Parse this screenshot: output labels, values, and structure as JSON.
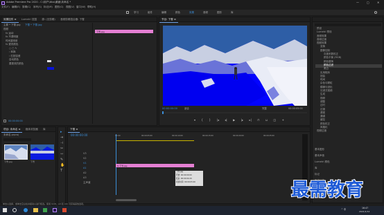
{
  "app": {
    "title": "Adobe Premiere Pro 2020 - C:\\用户\\ttbx\\桌面\\未命名 *",
    "window_controls": [
      "—",
      "▢",
      "✕"
    ]
  },
  "menu": [
    "文件(F)",
    "编辑(E)",
    "剪辑(C)",
    "序列(S)",
    "标记(M)",
    "图形(G)",
    "视图(V)",
    "窗口(W)",
    "帮助(H)"
  ],
  "workspace_tabs": [
    "学习",
    "组件",
    "编辑",
    "颜色",
    "效果",
    "音频",
    "图形",
    "库"
  ],
  "workspace_active": "效果",
  "effect_controls": {
    "tabs": [
      "效果控件 ≡",
      "Lumetri 范围",
      "源: (无剪辑)",
      "音频剪辑混合器: 下雪"
    ],
    "master": "主要 * 下雪.jpg",
    "clip": "下雪 * 下雪.jpg",
    "timecode_label": "▸",
    "rows": [
      {
        "label": "视频",
        "indent": 0
      },
      {
        "label": "fx 运动",
        "indent": 1
      },
      {
        "label": "fx 不透明度",
        "indent": 1
      },
      {
        "label": "时间重映射",
        "indent": 1
      },
      {
        "label": "fx 更改颜色",
        "indent": 1
      },
      {
        "label": "○ □ ✎",
        "indent": 2
      },
      {
        "label": "› 转换",
        "indent": 2
      },
      {
        "label": "› 匹配容差",
        "indent": 2
      },
      {
        "label": "自动颜色",
        "indent": 2
      },
      {
        "label": "要更改的颜色",
        "indent": 2
      }
    ],
    "clip_bar_label": "下雪.jpg",
    "bottom_timecode": "00:00:00:00"
  },
  "program": {
    "tab": "节目: 下雪 ≡",
    "timecode": "00:00:00:00",
    "fit": "适合",
    "ratio": "完整",
    "duration": "00:00:05:00"
  },
  "effects_panel": {
    "items": [
      {
        "label": "预设",
        "indent": 0
      },
      {
        "label": "Lumetri 预设",
        "indent": 0
      },
      {
        "label": "音频效果",
        "indent": 0
      },
      {
        "label": "音频过渡",
        "indent": 0
      },
      {
        "label": "视频效果",
        "indent": 0
      },
      {
        "label": "变换",
        "indent": 1
      },
      {
        "label": "图像控制",
        "indent": 1
      },
      {
        "label": "灰度系数校正",
        "indent": 2
      },
      {
        "label": "颜色平衡 (RGB)",
        "indent": 2
      },
      {
        "label": "颜色替换",
        "indent": 2
      },
      {
        "label": "颜色过滤",
        "indent": 2,
        "selected": true
      },
      {
        "label": "黑白",
        "indent": 2
      },
      {
        "label": "实用程序",
        "indent": 1
      },
      {
        "label": "扭曲",
        "indent": 1
      },
      {
        "label": "时间",
        "indent": 1
      },
      {
        "label": "杂色与颗粒",
        "indent": 1
      },
      {
        "label": "模糊与锐化",
        "indent": 1
      },
      {
        "label": "沉浸式视频",
        "indent": 1
      },
      {
        "label": "生成",
        "indent": 1
      },
      {
        "label": "视频",
        "indent": 1
      },
      {
        "label": "调整",
        "indent": 1
      },
      {
        "label": "过时",
        "indent": 1
      },
      {
        "label": "过渡",
        "indent": 1
      },
      {
        "label": "透视",
        "indent": 1
      },
      {
        "label": "通道",
        "indent": 1
      },
      {
        "label": "键控",
        "indent": 1
      },
      {
        "label": "颜色校正",
        "indent": 1
      },
      {
        "label": "风格化",
        "indent": 1
      },
      {
        "label": "视频过渡",
        "indent": 0
      }
    ],
    "footer": [
      "基本图形",
      "基本声音",
      "Lumetri 颜色",
      "库",
      "标记",
      "历史记录",
      "信息"
    ]
  },
  "project": {
    "tabs": [
      "项目: 未命名 ≡",
      "媒体浏览器",
      "库"
    ],
    "name": "未命名.prproj",
    "thumbs": [
      {
        "label": "下雪.jpg",
        "dur": "5:00"
      },
      {
        "label": "下雪",
        "dur": "5:00"
      }
    ]
  },
  "timeline": {
    "tab": "下雪 ≡",
    "timecode": "00:00:00:00",
    "ruler": [
      "00:00",
      "00:00:05:00",
      "00:00:10:00",
      "00:00:15:00",
      "00:00:20:00",
      "00:00:25:00",
      "00:00:30:00"
    ],
    "tracks": [
      "V3",
      "V2",
      "V1",
      "A1",
      "A2",
      "A3"
    ],
    "clip_label": "fx 下雪.jpg",
    "tooltip": {
      "name": "下雪.jpg",
      "start": "开始: 00:00:00:00",
      "end": "结束: 00:00:04:29",
      "dur": "持续时间: 00:00:05:00"
    },
    "master": "主声道"
  },
  "status_text": "单击以选择，或单击空白处并拖动以进行框选。使用 Shift、Alt 和 Ctrl 可获得其他选项。",
  "taskbar": {
    "time": "16:47",
    "date": "2021/1/12",
    "tray": "^ 中"
  },
  "watermark": "最需教育",
  "colors": {
    "accent": "#3b8ed8",
    "clip_pink": "#e47fd3",
    "selection_blue": "#2d5fa3"
  }
}
